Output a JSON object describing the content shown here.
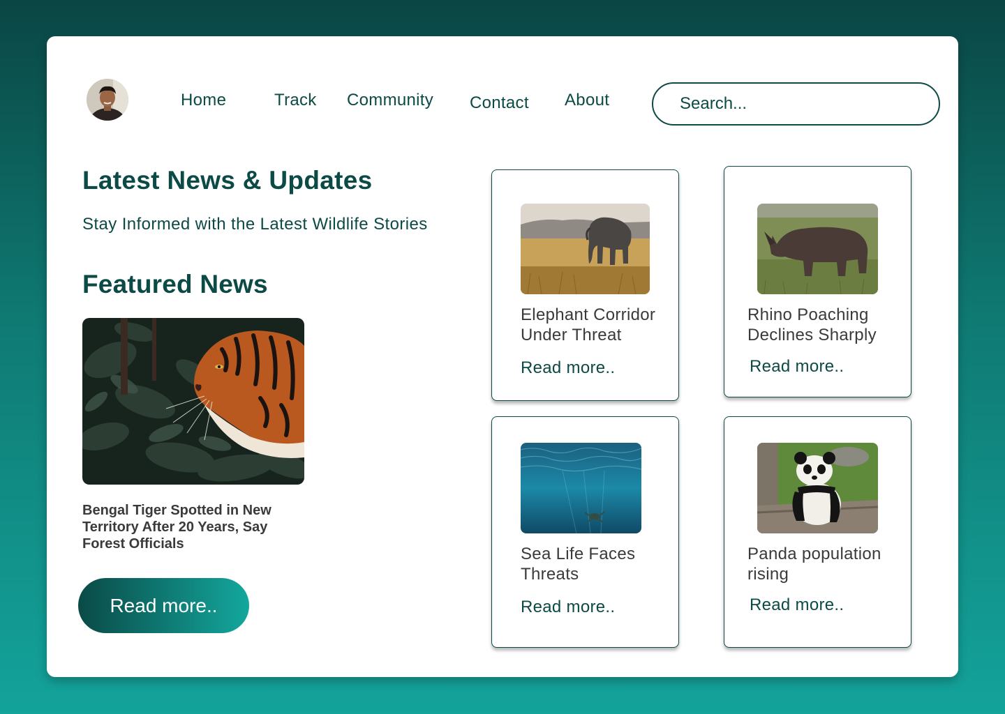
{
  "header": {
    "avatar_alt": "User profile photo",
    "nav": [
      {
        "label": "Home"
      },
      {
        "label": "Track"
      },
      {
        "label": "Community"
      },
      {
        "label": "Contact"
      },
      {
        "label": "About"
      }
    ],
    "search": {
      "placeholder": "Search..."
    }
  },
  "main": {
    "title": "Latest News & Updates",
    "subtitle": "Stay Informed with the Latest Wildlife Stories",
    "featured": {
      "heading": "Featured News",
      "image": "tiger-photo",
      "headline": "Bengal Tiger Spotted in New Territory After 20 Years, Say Forest Officials",
      "cta_label": "Read more.."
    },
    "cards": [
      {
        "image": "elephant-photo",
        "title": "Elephant Corridor Under Threat",
        "link": "Read more.."
      },
      {
        "image": "rhino-photo",
        "title": "Rhino Poaching Declines Sharply",
        "link": "Read more.."
      },
      {
        "image": "sea-turtle-photo",
        "title": "Sea Life Faces Threats",
        "link": "Read more.."
      },
      {
        "image": "panda-photo",
        "title": "Panda population rising",
        "link": "Read more.."
      }
    ]
  },
  "colors": {
    "primary": "#0b4a45",
    "accent": "#13a39b",
    "text_dark": "#3a3a3a",
    "surface": "#ffffff"
  }
}
